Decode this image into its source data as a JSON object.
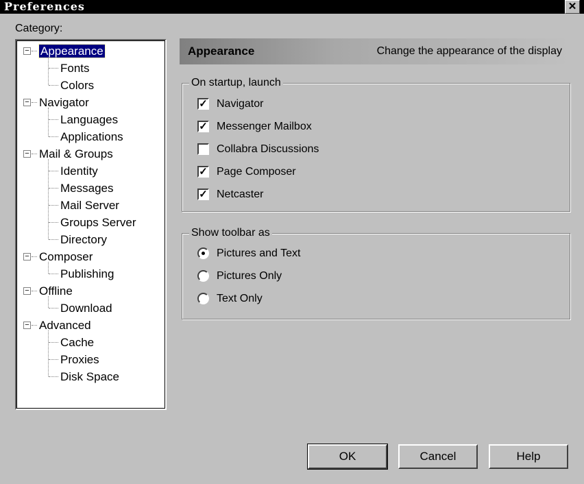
{
  "window": {
    "title": "Preferences",
    "close_glyph": "✕"
  },
  "category_label": "Category:",
  "tree": [
    {
      "label": "Appearance",
      "level": 0,
      "expander": "−",
      "selected": true
    },
    {
      "label": "Fonts",
      "level": 1
    },
    {
      "label": "Colors",
      "level": 1
    },
    {
      "label": "Navigator",
      "level": 0,
      "expander": "−"
    },
    {
      "label": "Languages",
      "level": 1
    },
    {
      "label": "Applications",
      "level": 1
    },
    {
      "label": "Mail & Groups",
      "level": 0,
      "expander": "−"
    },
    {
      "label": "Identity",
      "level": 1
    },
    {
      "label": "Messages",
      "level": 1
    },
    {
      "label": "Mail Server",
      "level": 1
    },
    {
      "label": "Groups Server",
      "level": 1
    },
    {
      "label": "Directory",
      "level": 1
    },
    {
      "label": "Composer",
      "level": 0,
      "expander": "−"
    },
    {
      "label": "Publishing",
      "level": 1
    },
    {
      "label": "Offline",
      "level": 0,
      "expander": "−"
    },
    {
      "label": "Download",
      "level": 1
    },
    {
      "label": "Advanced",
      "level": 0,
      "expander": "−"
    },
    {
      "label": "Cache",
      "level": 1
    },
    {
      "label": "Proxies",
      "level": 1
    },
    {
      "label": "Disk Space",
      "level": 1
    }
  ],
  "header": {
    "title": "Appearance",
    "description": "Change the appearance of the display"
  },
  "startup": {
    "legend": "On startup, launch",
    "options": [
      {
        "label": "Navigator",
        "checked": true
      },
      {
        "label": "Messenger Mailbox",
        "checked": true
      },
      {
        "label": "Collabra Discussions",
        "checked": false
      },
      {
        "label": "Page Composer",
        "checked": true
      },
      {
        "label": "Netcaster",
        "checked": true
      }
    ]
  },
  "toolbar": {
    "legend": "Show toolbar as",
    "options": [
      {
        "label": "Pictures and Text",
        "selected": true
      },
      {
        "label": "Pictures Only",
        "selected": false
      },
      {
        "label": "Text Only",
        "selected": false
      }
    ]
  },
  "buttons": {
    "ok": "OK",
    "cancel": "Cancel",
    "help": "Help"
  }
}
